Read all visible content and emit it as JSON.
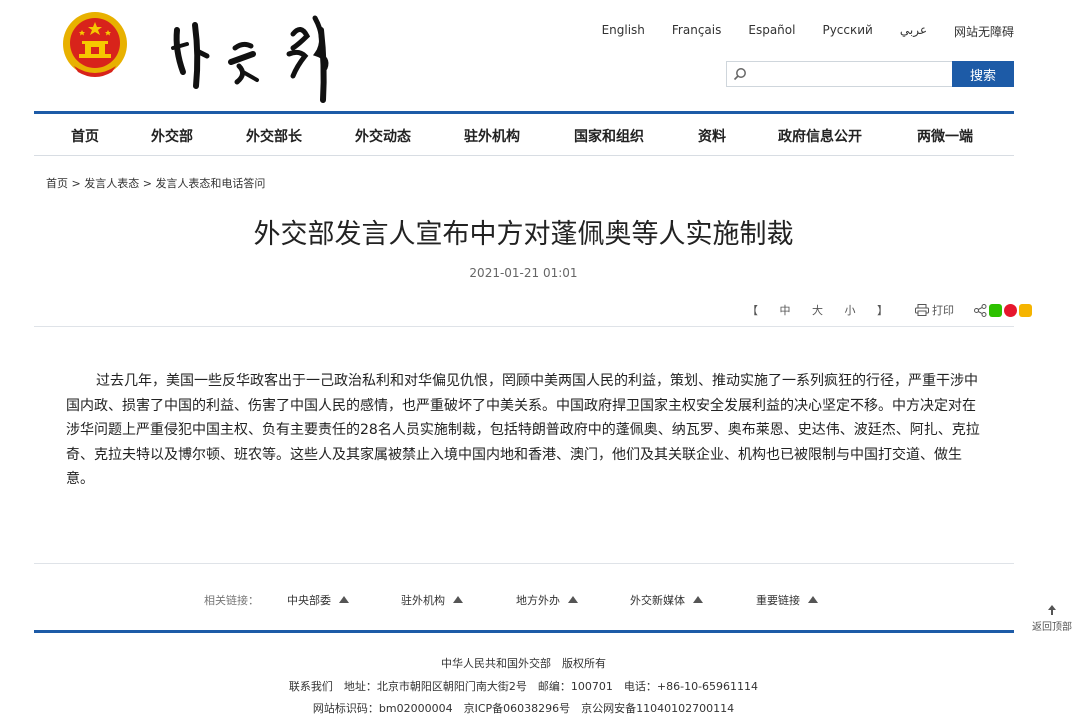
{
  "header": {
    "logo_text": "外交部",
    "languages": [
      "English",
      "Français",
      "Español",
      "Русский",
      "عربي",
      "网站无障碍"
    ],
    "search": {
      "placeholder": "",
      "button_label": "搜索"
    }
  },
  "nav": {
    "items": [
      "首页",
      "外交部",
      "外交部长",
      "外交动态",
      "驻外机构",
      "国家和组织",
      "资料",
      "政府信息公开",
      "两微一端"
    ]
  },
  "breadcrumb": [
    "首页",
    "发言人表态",
    "发言人表态和电话答问"
  ],
  "breadcrumb_sep": ">",
  "article": {
    "title": "外交部发言人宣布中方对蓬佩奥等人实施制裁",
    "date": "2021-01-21 01:01",
    "font_sizes": "【 中 大 小 】",
    "print_label": "打印",
    "body": "过去几年，美国一些反华政客出于一己政治私利和对华偏见仇恨，罔顾中美两国人民的利益，策划、推动实施了一系列疯狂的行径，严重干涉中国内政、损害了中国的利益、伤害了中国人民的感情，也严重破坏了中美关系。中国政府捍卫国家主权安全发展利益的决心坚定不移。中方决定对在涉华问题上严重侵犯中国主权、负有主要责任的28名人员实施制裁，包括特朗普政府中的蓬佩奥、纳瓦罗、奥布莱恩、史达伟、波廷杰、阿扎、克拉奇、克拉夫特以及博尔顿、班农等。这些人及其家属被禁止入境中国内地和香港、澳门，他们及其关联企业、机构也已被限制与中国打交道、做生意。"
  },
  "related_links": {
    "label": "相关链接：",
    "items": [
      "中央部委",
      "驻外机构",
      "地方外办",
      "外交新媒体",
      "重要链接"
    ]
  },
  "footer": {
    "line1": "中华人民共和国外交部　版权所有",
    "line2": "联系我们　地址：北京市朝阳区朝阳门南大街2号　邮编：100701　电话：+86-10-65961114",
    "line3": "网站标识码：bm02000004　京ICP备06038296号　京公网安备11040102700114"
  },
  "back_to_top": "返回顶部",
  "colors": {
    "brand_blue": "#1d5ba7"
  }
}
